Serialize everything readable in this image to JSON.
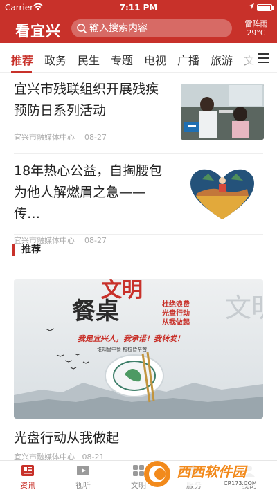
{
  "status": {
    "carrier": "Carrier",
    "time": "7:11 PM"
  },
  "header": {
    "logo": "看宜兴",
    "search_placeholder": "输入搜索内容",
    "weather_condition": "雷阵雨",
    "weather_temp": "29°C"
  },
  "tabs": [
    "推荐",
    "政务",
    "民生",
    "专题",
    "电视",
    "广播",
    "旅游",
    "文"
  ],
  "articles": [
    {
      "title": "宜兴市残联组织开展残疾预防日系列活动",
      "source": "宜兴市融媒体中心",
      "date": "08-27"
    },
    {
      "title": "18年热心公益，自掏腰包为他人解燃眉之急—— 传…",
      "source": "宜兴市融媒体中心",
      "date": "08-27"
    }
  ],
  "section": {
    "title": "推荐"
  },
  "banner": {
    "title": "光盘行动从我做起",
    "source": "宜兴市融媒体中心",
    "date": "08-21",
    "poster_text": {
      "headline_a": "文明",
      "headline_b": "餐桌",
      "side_line_1": "杜绝浪费",
      "side_line_2": "光盘行动",
      "side_line_3": "从我做起",
      "slogan": "我是宜兴人，我承诺！我转发！",
      "subline": "谁知盘中餐 粒粒皆辛苦",
      "bg_chars": "文明光盘"
    }
  },
  "bottom_nav": [
    {
      "label": "资讯",
      "icon": "news-icon",
      "active": true
    },
    {
      "label": "视听",
      "icon": "video-icon",
      "active": false
    },
    {
      "label": "文明",
      "icon": "civil-icon",
      "active": false
    },
    {
      "label": "服务",
      "icon": "service-icon",
      "active": false
    },
    {
      "label": "我的",
      "icon": "profile-icon",
      "active": false
    }
  ],
  "watermark": {
    "name": "西西软件园",
    "url": "CR173.COM"
  },
  "colors": {
    "brand": "#c8312a",
    "meta": "#aaaaaa"
  }
}
